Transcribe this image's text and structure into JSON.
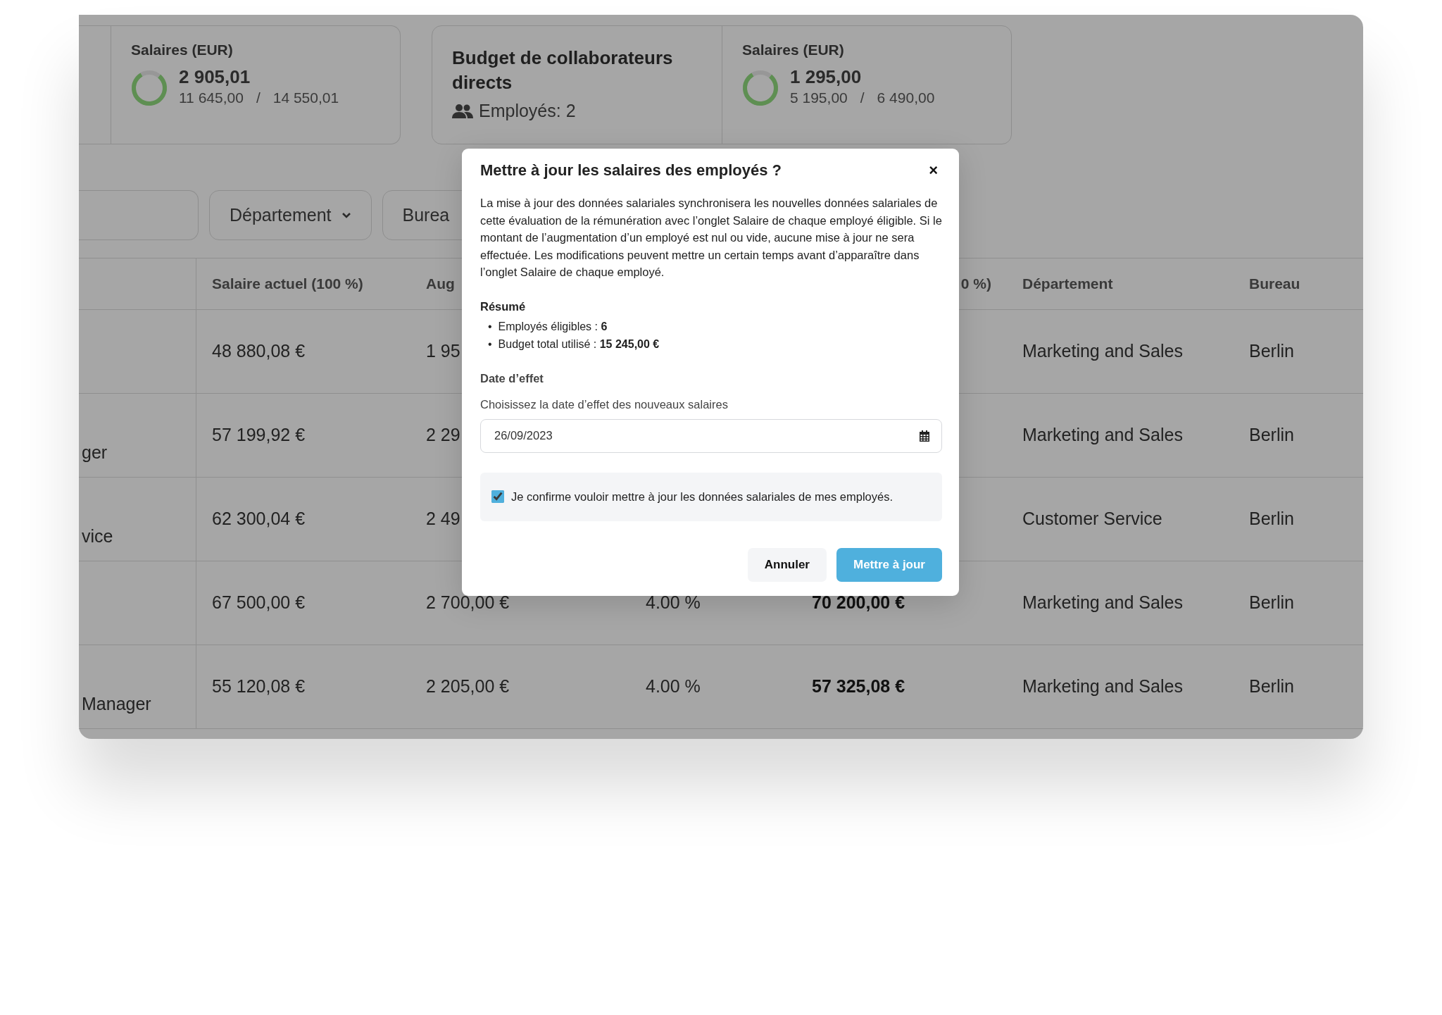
{
  "cards": [
    {
      "sections": [
        {
          "kind": "salary",
          "title": "Salaires (EUR)",
          "value": "2 905,01",
          "used": "11 645,00",
          "separator": "/",
          "total": "14 550,01",
          "level": 0.8
        }
      ]
    },
    {
      "sections": [
        {
          "kind": "budget",
          "title": "Budget de collaborateurs directs",
          "employees": "Employés: 2"
        },
        {
          "kind": "salary",
          "title": "Salaires (EUR)",
          "value": "1 295,00",
          "used": "5 195,00",
          "separator": "/",
          "total": "6 490,00",
          "level": 0.8
        }
      ]
    }
  ],
  "filters": [
    {
      "kind": "search"
    },
    {
      "kind": "dropdown",
      "label": "Département"
    },
    {
      "kind": "dropdown",
      "label": "Burea"
    }
  ],
  "table": {
    "header": {
      "current_salary": "Salaire actuel (100 %)",
      "column_3": "Aug",
      "column_5": "0 %)",
      "department": "Département",
      "office": "Bureau"
    },
    "rows": [
      {
        "current_salary": "48 880,08 €",
        "column_3": "1 95",
        "department": "Marketing and Sales",
        "office": "Berlin"
      },
      {
        "column_1": "ger",
        "current_salary": "57 199,92 €",
        "column_3": "2 29",
        "department": "Marketing and Sales",
        "office": "Berlin"
      },
      {
        "column_1": "vice",
        "current_salary": "62 300,04 €",
        "column_3": "2 49",
        "department": "Customer Service",
        "office": "Berlin"
      },
      {
        "current_salary": "67 500,00 €",
        "column_3": "2 700,00 €",
        "column_4": "4.00 %",
        "column_5": "70 200,00 €",
        "department": "Marketing and Sales",
        "office": "Berlin"
      },
      {
        "column_1": "Manager",
        "current_salary": "55 120,08 €",
        "column_3": "2 205,00 €",
        "column_4": "4.00 %",
        "column_5": "57 325,08 €",
        "department": "Marketing and Sales",
        "office": "Berlin"
      }
    ]
  },
  "modal": {
    "title": "Mettre à jour les salaires des employés ?",
    "close": "×",
    "description": "La mise à jour des données salariales synchronisera les nouvelles données salariales de cette évaluation de la rémunération avec l’onglet Salaire de chaque employé éligible. Si le montant de l’augmentation d’un employé est nul ou vide, aucune mise à jour ne sera effectuée. Les modifications peuvent mettre un certain temps avant d’apparaître dans l’onglet Salaire de chaque employé.",
    "summary_heading": "Résumé",
    "summary_items": [
      {
        "bullet": "•",
        "text": "Employés éligibles : **6**"
      },
      {
        "bullet": "•",
        "text": "Budget total utilisé : **15 245,00 €**"
      }
    ],
    "date_heading": "Date d’effet",
    "date_label": "Choisissez la date d’effet des nouveaux salaires",
    "date_value": "26/09/2023",
    "confirm": {
      "label": "Je confirme vouloir mettre à jour les données salariales de mes employés.",
      "checked": true
    },
    "buttons": [
      {
        "label": "Annuler",
        "kind": "secondary"
      },
      {
        "label": "Mettre à jour",
        "kind": "primary"
      }
    ]
  }
}
